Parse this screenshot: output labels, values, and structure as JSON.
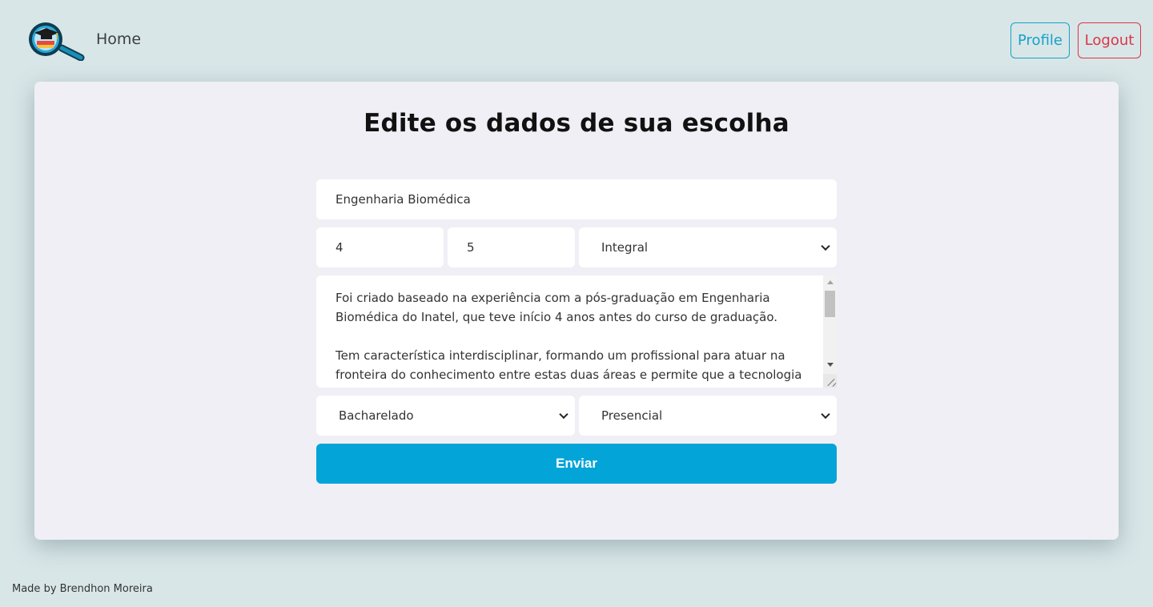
{
  "nav": {
    "logo_icon": "graduation-cap-magnifier-icon",
    "home_label": "Home",
    "profile_label": "Profile",
    "logout_label": "Logout",
    "colors": {
      "profile": "#17a2c8",
      "logout": "#dc3545"
    }
  },
  "form": {
    "title": "Edite os dados de sua escolha",
    "course_name": "Engenharia Biomédica",
    "years": "4",
    "semesters": "5",
    "period": "Integral",
    "description": "Foi criado baseado na experiência com a pós-graduação em Engenharia Biomédica do Inatel, que teve início 4 anos antes do curso de graduação.\n\nTem característica interdisciplinar, formando um profissional para atuar na fronteira do conhecimento entre estas duas áreas e permite que a tecnologia seja",
    "degree": "Bacharelado",
    "modality": "Presencial",
    "submit_label": "Enviar",
    "submit_color": "#03a4d7"
  },
  "footer": {
    "text": "Made by Brendhon Moreira"
  }
}
